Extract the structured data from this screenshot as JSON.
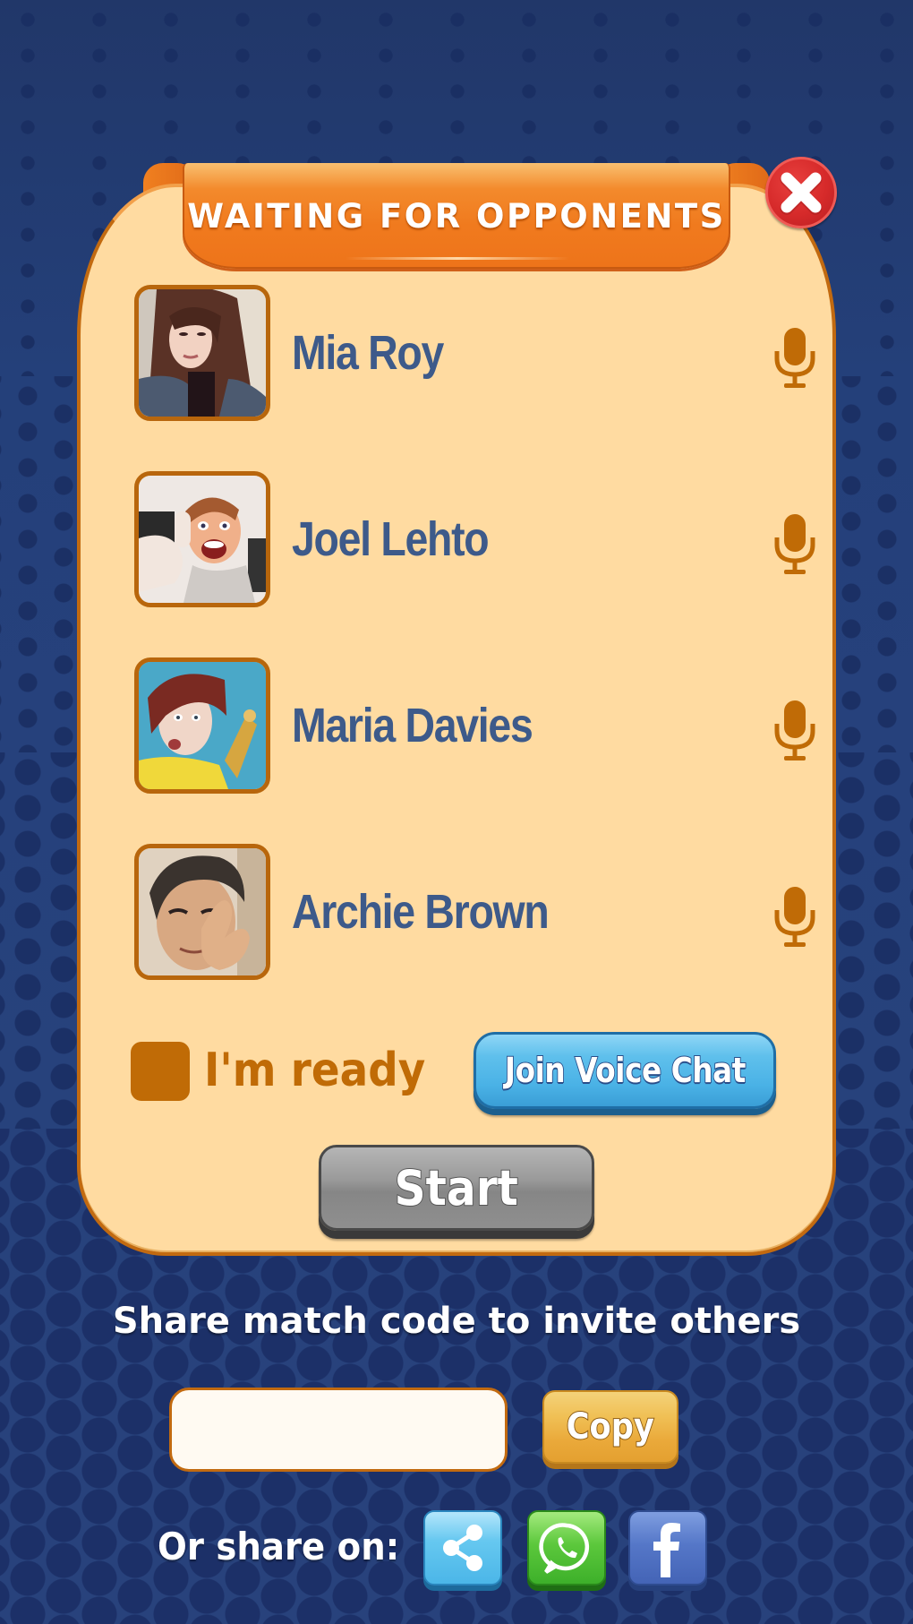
{
  "dialog": {
    "title": "WAITING FOR OPPONENTS",
    "close_icon": "close-icon"
  },
  "players": [
    {
      "name": "Mia Roy",
      "avatar": "photo-mia-roy",
      "mic_icon": "microphone-icon"
    },
    {
      "name": "Joel Lehto",
      "avatar": "photo-joel-lehto",
      "mic_icon": "microphone-icon"
    },
    {
      "name": "Maria Davies",
      "avatar": "photo-maria-davies",
      "mic_icon": "microphone-icon"
    },
    {
      "name": "Archie Brown",
      "avatar": "photo-archie-brown",
      "mic_icon": "microphone-icon"
    }
  ],
  "ready": {
    "label": "I'm ready",
    "checked": false
  },
  "buttons": {
    "join_voice_chat": "Join Voice Chat",
    "start": "Start",
    "copy": "Copy"
  },
  "share": {
    "title": "Share match code to invite others",
    "code_value": "",
    "or_share_on": "Or share on:",
    "targets": [
      {
        "name": "share",
        "icon": "share-icon"
      },
      {
        "name": "WhatsApp",
        "icon": "whatsapp-icon"
      },
      {
        "name": "Facebook",
        "icon": "facebook-icon"
      }
    ]
  },
  "colors": {
    "background": "#233a72",
    "panel": "#ffdba1",
    "panel_border": "#c26a10",
    "ribbon": "#f07a1e",
    "name_text": "#3d5a8a",
    "accent_brown": "#c06b06",
    "voice_button": "#4ab2e6",
    "start_button": "#8f8f8f",
    "copy_button": "#eaa93a",
    "close_button": "#d62a2a"
  }
}
